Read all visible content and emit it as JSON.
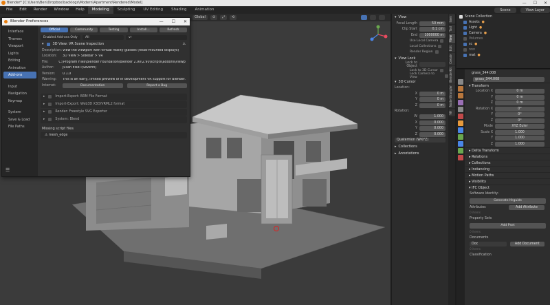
{
  "window": {
    "title": "Blender* [C:\\Users\\Ben\\Dropbox\\backlogs\\Modern\\Apartment\\Rendered\\Model]",
    "controls": [
      "—",
      "☐",
      "✕"
    ]
  },
  "menubar": {
    "items": [
      "File",
      "Edit",
      "Render",
      "Window",
      "Help"
    ],
    "workspaces": [
      "Modeling",
      "Sculpting",
      "UV Editing",
      "Shading",
      "Animation"
    ],
    "active_workspace": "Modeling",
    "scene": "Scene",
    "view_layer": "View Layer"
  },
  "viewport_header": {
    "transform": "Global",
    "mode_buttons": [
      "⊙",
      "⤢",
      "⟲"
    ]
  },
  "prefs": {
    "title": "Blender Preferences",
    "controls": [
      "—",
      "☐",
      "✕"
    ],
    "sidebar": [
      "Interface",
      "Themes",
      "Viewport",
      "Lights",
      "Editing",
      "Animation",
      "Add-ons",
      "Input",
      "Navigation",
      "Keymap",
      "System",
      "Save & Load",
      "File Paths"
    ],
    "active_sidebar": "Add-ons",
    "tabs": [
      "Official",
      "Community",
      "Testing",
      "Install...",
      "Refresh"
    ],
    "active_tab": "Official",
    "filter_dropdown": "Enabled Add-ons Only",
    "category_dropdown": "All",
    "search_value": "vr",
    "addon": {
      "name": "3D View: VR Scene Inspection",
      "description_label": "Description:",
      "description": "View the viewport with virtual reality glasses (head-mounted displays)",
      "location_label": "Location:",
      "location": "3D View > Sidebar > VR",
      "file_label": "File:",
      "file": "C:\\Program Files\\Blender Foundation\\Blender 2.90\\2.90\\scripts\\addons\\viewport_vr_preview.py",
      "author_label": "Author:",
      "author": "Julian Eisel (Severin)",
      "version_label": "Version:",
      "version": "0.1.0",
      "warning_label": "Warning:",
      "warning": "This is an early, limited preview of in development VR support for Blender.",
      "internet_label": "Internet:",
      "doc_button": "Documentation",
      "bug_button": "Report a Bug"
    },
    "other_addons": [
      "Import-Export: BRM File Format",
      "Import-Export: Web3D X3D/VRML2 format",
      "Render: Freestyle SVG Exporter",
      "System: Blend"
    ],
    "missing_header": "Missing script files",
    "missing": [
      "mesh_edge"
    ]
  },
  "npanel": {
    "view_section": "View",
    "focal_label": "Focal Length",
    "focal_value": "50 mm",
    "clip_label": "Clip Start",
    "clip_start": "0.1 cm",
    "end_label": "End",
    "clip_end": "1000000 m",
    "local_camera": "Use Local Camera",
    "local_collections": "Local Collections",
    "render_region": "Render Region",
    "view_lock_section": "View Lock",
    "lock_object_label": "Lock to Object",
    "lock_3d_cursor": "Lock to 3D Cursor",
    "lock_camera": "Lock Camera to View",
    "cursor_section": "3D Cursor",
    "location_label": "Location:",
    "cursor_loc": [
      {
        "k": "X",
        "v": "0 m"
      },
      {
        "k": "Y",
        "v": "0 m"
      },
      {
        "k": "Z",
        "v": "0 m"
      }
    ],
    "rotation_label": "Rotation:",
    "cursor_rot": [
      {
        "k": "W",
        "v": "1.000"
      },
      {
        "k": "X",
        "v": "0.000"
      },
      {
        "k": "Y",
        "v": "0.000"
      },
      {
        "k": "Z",
        "v": "0.000"
      }
    ],
    "rotation_mode": "Quaternion (WXYZ)",
    "collections_section": "Collections",
    "annotations_section": "Annotations"
  },
  "vtabs": [
    "Item",
    "Tool",
    "View",
    "Edit",
    "Create",
    "BlenderKit",
    "Node Wrangler",
    "VR"
  ],
  "outliner": {
    "scene_collection": "Scene Collection",
    "rows": [
      "Assets",
      "Light",
      "Camera",
      "Volumes",
      "sc",
      "nnn",
      "mat"
    ]
  },
  "properties": {
    "object_name": "grass_344.008",
    "object_field": "grass_344.008",
    "transforms_section": "Transform",
    "location_label": "Location X",
    "loc": [
      {
        "k": "Location X",
        "v": "0 m"
      },
      {
        "k": "Y",
        "v": "0 m"
      },
      {
        "k": "Z",
        "v": "0 m"
      }
    ],
    "rot": [
      {
        "k": "Rotation X",
        "v": "0°"
      },
      {
        "k": "Y",
        "v": "0°"
      },
      {
        "k": "Z",
        "v": "0°"
      }
    ],
    "mode_label": "Mode",
    "mode_value": "XYZ Euler",
    "scale": [
      {
        "k": "Scale X",
        "v": "1.000"
      },
      {
        "k": "Y",
        "v": "1.000"
      },
      {
        "k": "Z",
        "v": "1.000"
      }
    ],
    "sections": [
      "Delta Transform",
      "Relations",
      "Collections",
      "Instancing",
      "Motion Paths",
      "Visibility",
      "IFC Object"
    ],
    "software_label": "Software Identity:",
    "generate_button": "Generate Ifcguids",
    "attributes_label": "Attributes",
    "add_attribute_button": "Add Attribute",
    "zero_items": "0 items",
    "property_sets_label": "Property Sets",
    "add_pset_button": "Add Pset",
    "documents_label": "Documents",
    "doc_value": "Doc",
    "add_document_button": "Add Document",
    "classification_label": "Classification"
  }
}
